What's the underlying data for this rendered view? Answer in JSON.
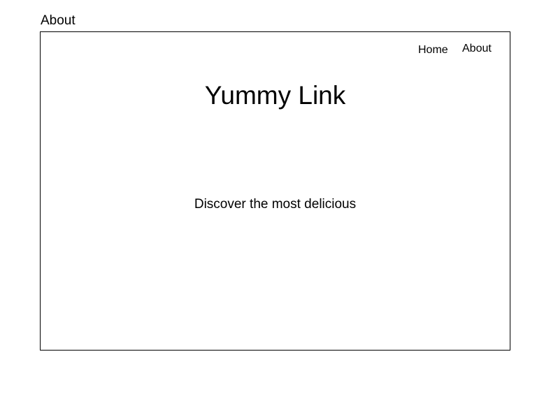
{
  "page": {
    "label": "About"
  },
  "nav": {
    "items": [
      {
        "label": "Home"
      },
      {
        "label": "About"
      }
    ]
  },
  "main": {
    "title": "Yummy Link",
    "tagline": "Discover the most delicious"
  }
}
